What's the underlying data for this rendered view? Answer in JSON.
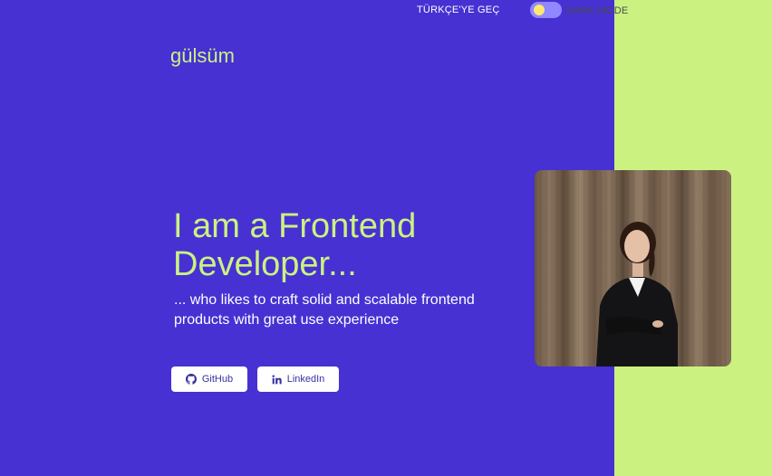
{
  "header": {
    "language_switch": "TÜRKÇE'YE GEÇ",
    "mode_label": "DARK MODE"
  },
  "logo": "gülsüm",
  "hero": {
    "headline": "I am a Frontend Developer...",
    "subline": "... who likes to craft solid and scalable frontend products with great use experience"
  },
  "buttons": {
    "github": "GitHub",
    "linkedin": "LinkedIn"
  },
  "colors": {
    "primary_bg": "#4731d3",
    "accent_bg": "#cbf281",
    "headline": "#cbf281",
    "button_text": "#3730a3"
  },
  "icons": {
    "github": "github-icon",
    "linkedin": "linkedin-icon"
  }
}
